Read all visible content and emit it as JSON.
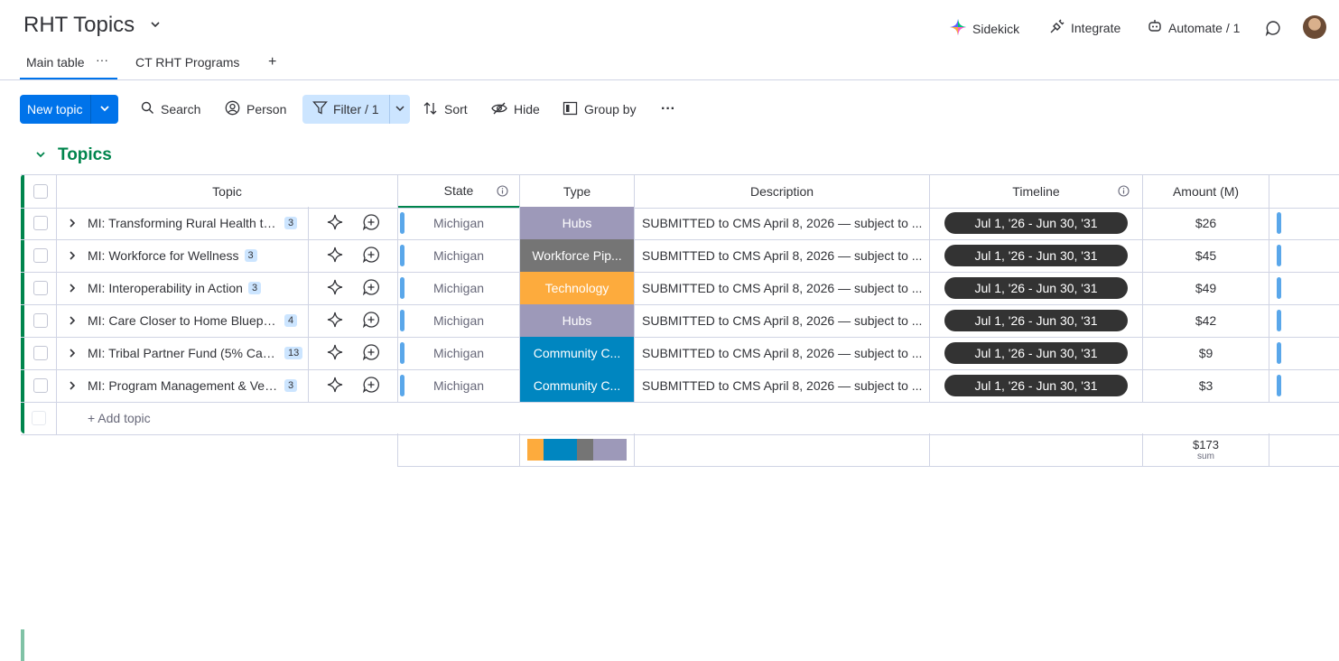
{
  "board": {
    "title": "RHT Topics"
  },
  "tabs": [
    {
      "label": "Main table",
      "active": true
    },
    {
      "label": "CT RHT Programs",
      "active": false
    }
  ],
  "header_actions": {
    "sidekick": "Sidekick",
    "integrate": "Integrate",
    "automate": "Automate / 1"
  },
  "toolbar": {
    "new_item": "New topic",
    "search": "Search",
    "person": "Person",
    "filter": "Filter / 1",
    "sort": "Sort",
    "hide": "Hide",
    "group_by": "Group by"
  },
  "group": {
    "title": "Topics",
    "color": "#00854d"
  },
  "columns": {
    "topic": "Topic",
    "state": "State",
    "type": "Type",
    "description": "Description",
    "timeline": "Timeline",
    "amount": "Amount (M)"
  },
  "rows": [
    {
      "topic": "MI: Transforming Rural Health th...",
      "count": "3",
      "state": "Michigan",
      "type": "Hubs",
      "type_color": "#9d99b9",
      "description": "SUBMITTED to CMS April 8, 2026 — subject to ...",
      "timeline": "Jul 1, '26 - Jun 30, '31",
      "amount": "$26"
    },
    {
      "topic": "MI: Workforce for Wellness",
      "count": "3",
      "state": "Michigan",
      "type": "Workforce Pip...",
      "type_color": "#757575",
      "description": "SUBMITTED to CMS April 8, 2026 — subject to ...",
      "timeline": "Jul 1, '26 - Jun 30, '31",
      "amount": "$45"
    },
    {
      "topic": "MI: Interoperability in Action",
      "count": "3",
      "state": "Michigan",
      "type": "Technology",
      "type_color": "#fdab3d",
      "description": "SUBMITTED to CMS April 8, 2026 — subject to ...",
      "timeline": "Jul 1, '26 - Jun 30, '31",
      "amount": "$49"
    },
    {
      "topic": "MI: Care Closer to Home Bluepri...",
      "count": "4",
      "state": "Michigan",
      "type": "Hubs",
      "type_color": "#9d99b9",
      "description": "SUBMITTED to CMS April 8, 2026 — subject to ...",
      "timeline": "Jul 1, '26 - Jun 30, '31",
      "amount": "$42"
    },
    {
      "topic": "MI: Tribal Partner Fund (5% Carv...",
      "count": "13",
      "state": "Michigan",
      "type": "Community C...",
      "type_color": "#0086c0",
      "description": "SUBMITTED to CMS April 8, 2026 — subject to ...",
      "timeline": "Jul 1, '26 - Jun 30, '31",
      "amount": "$9"
    },
    {
      "topic": "MI: Program Management & Ven...",
      "count": "3",
      "state": "Michigan",
      "type": "Community C...",
      "type_color": "#0086c0",
      "description": "SUBMITTED to CMS April 8, 2026 — subject to ...",
      "timeline": "Jul 1, '26 - Jun 30, '31",
      "amount": "$3"
    }
  ],
  "add_item": "+ Add topic",
  "footer": {
    "amount_sum": "$173",
    "amount_sum_label": "sum",
    "type_summary": [
      {
        "color": "#fdab3d",
        "fraction": 0.1667
      },
      {
        "color": "#0086c0",
        "fraction": 0.3333
      },
      {
        "color": "#757575",
        "fraction": 0.1667
      },
      {
        "color": "#9d99b9",
        "fraction": 0.3333
      }
    ]
  }
}
